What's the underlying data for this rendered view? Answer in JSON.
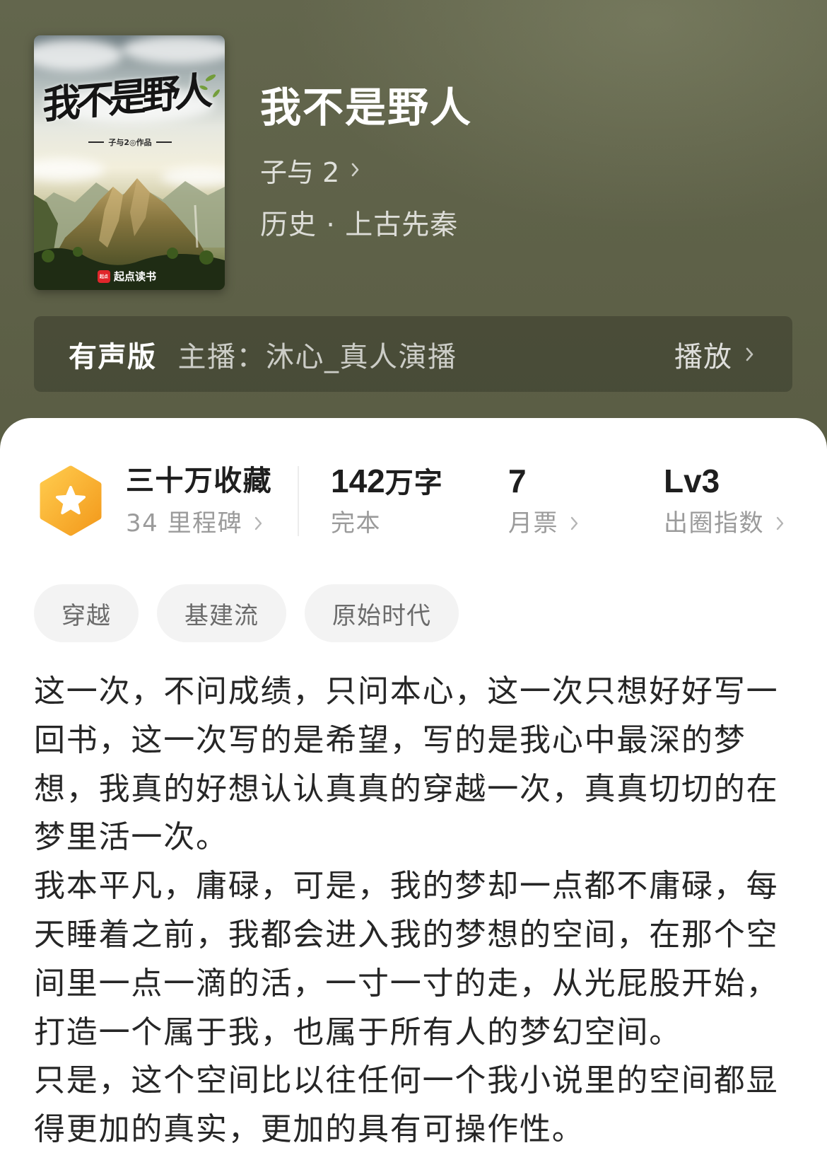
{
  "book": {
    "title": "我不是野人",
    "author": "子与 2",
    "genre": "历史 · 上古先秦",
    "cover": {
      "title": "我不是野人",
      "byline": "子与2◎作品",
      "publisher_badge": "起点",
      "publisher_logo": "起点读书"
    }
  },
  "audio": {
    "label": "有声版",
    "narrator": "主播：沐心_真人演播",
    "play_label": "播放"
  },
  "stats": {
    "collections": {
      "value": "三十万收藏",
      "label": "34 里程碑"
    },
    "word_count": {
      "number": "142",
      "unit": "万字",
      "label": "完本"
    },
    "monthly_tickets": {
      "value": "7",
      "label": "月票"
    },
    "popularity": {
      "value": "Lv3",
      "label": "出圈指数"
    }
  },
  "tags": [
    "穿越",
    "基建流",
    "原始时代"
  ],
  "description": [
    "这一次，不问成绩，只问本心，这一次只想好好写一回书，这一次写的是希望，写的是我心中最深的梦想，我真的好想认认真真的穿越一次，真真切切的在梦里活一次。",
    "我本平凡，庸碌，可是，我的梦却一点都不庸碌，每天睡着之前，我都会进入我的梦想的空间，在那个空间里一点一滴的活，一寸一寸的走，从光屁股开始，打造一个属于我，也属于所有人的梦幻空间。",
    "只是，这个空间比以往任何一个我小说里的空间都显得更加的真实，更加的具有可操作性。"
  ],
  "icons": {
    "badge": "star-hexagon-icon",
    "chevron": "chevron-right-icon"
  },
  "theme": {
    "header_bg": "#5a5d44",
    "badge_orange": "#f5a623",
    "text_primary": "#1e1e1e",
    "text_secondary": "#9b9b9b",
    "tag_bg": "#f3f3f3",
    "publisher_red": "#e0262b"
  }
}
